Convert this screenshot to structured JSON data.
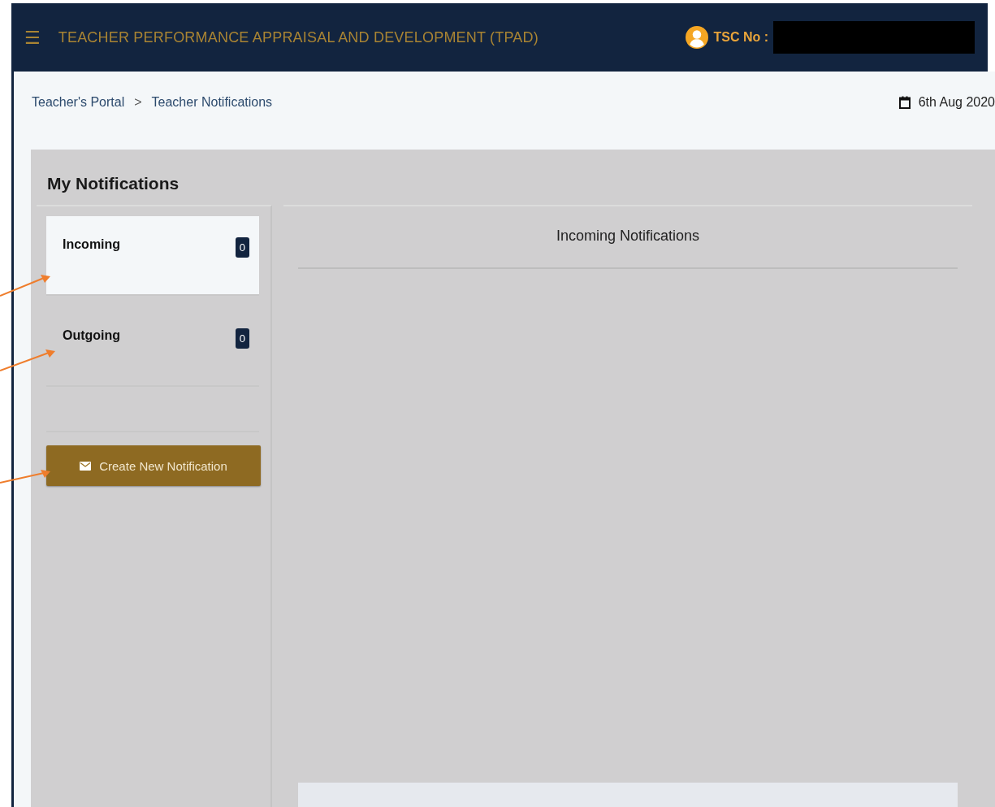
{
  "header": {
    "menu_icon": "☰",
    "title": "TEACHER PERFORMANCE APPRAISAL AND DEVELOPMENT (TPAD)",
    "user_label": "TSC No :"
  },
  "breadcrumb": [
    "Teacher's Portal",
    "Teacher Notifications"
  ],
  "breadcrumb_separator": ">",
  "date": "6th Aug 2020",
  "section_title": "My Notifications",
  "folders": [
    {
      "label": "Incoming",
      "count": "0",
      "selected": true
    },
    {
      "label": "Outgoing",
      "count": "0",
      "selected": false
    }
  ],
  "create_button": "Create New Notification",
  "panel_title": "Incoming Notifications",
  "annotation_arrows": [
    {
      "kind": "arrow"
    },
    {
      "kind": "arrow"
    },
    {
      "kind": "arrow"
    }
  ]
}
